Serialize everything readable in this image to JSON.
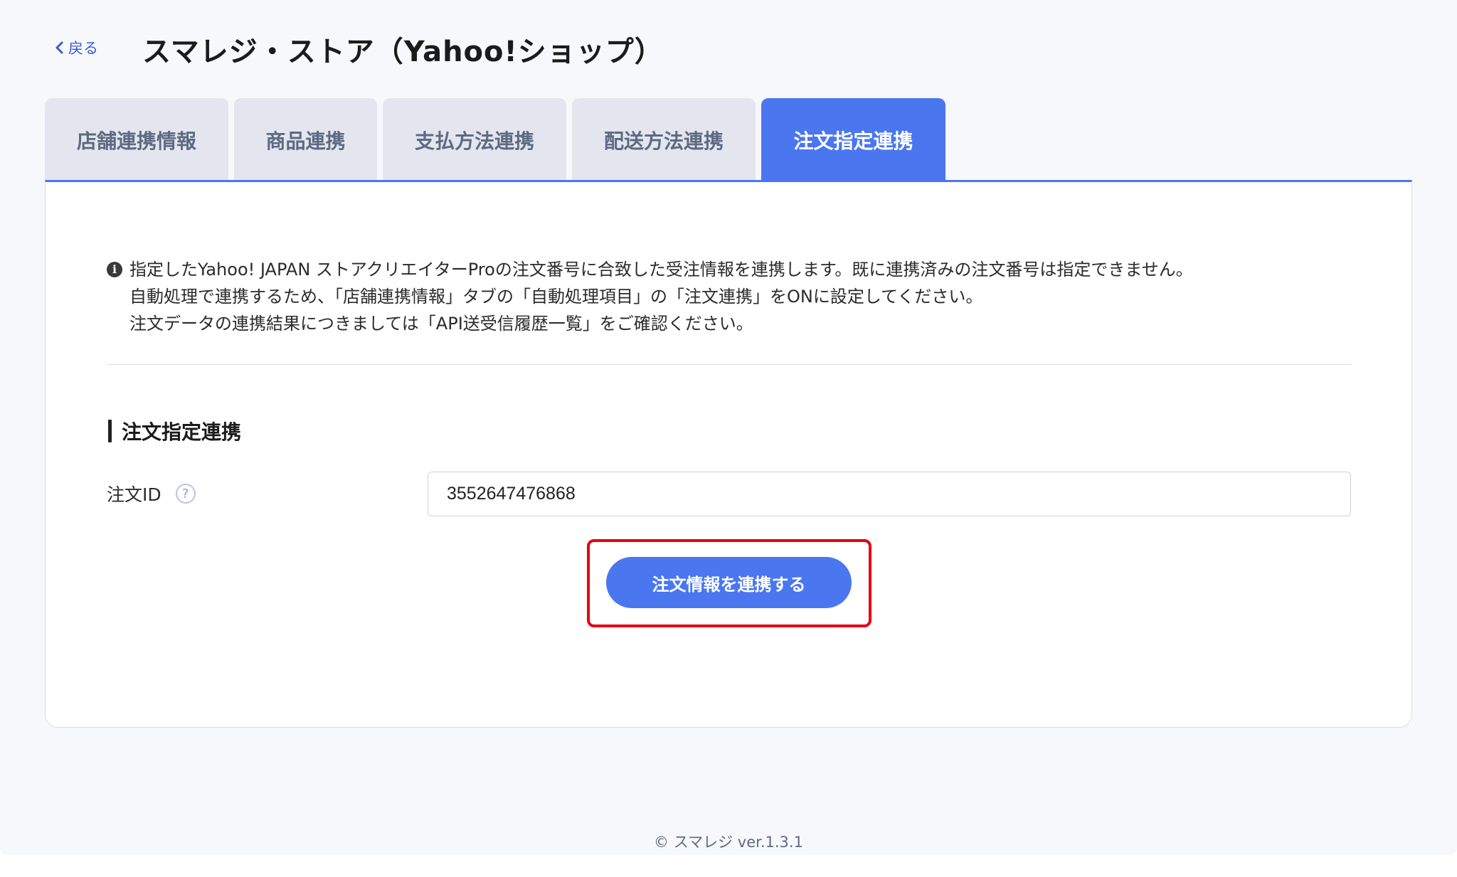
{
  "header": {
    "back_label": "戻る",
    "title": "スマレジ・ストア（Yahoo!ショップ）"
  },
  "tabs": [
    {
      "label": "店舗連携情報",
      "active": false
    },
    {
      "label": "商品連携",
      "active": false
    },
    {
      "label": "支払方法連携",
      "active": false
    },
    {
      "label": "配送方法連携",
      "active": false
    },
    {
      "label": "注文指定連携",
      "active": true
    }
  ],
  "info": {
    "icon": "info-icon",
    "lines": [
      "指定したYahoo! JAPAN ストアクリエイターProの注文番号に合致した受注情報を連携します。既に連携済みの注文番号は指定できません。",
      "自動処理で連携するため、「店舗連携情報」タブの「自動処理項目」の「注文連携」をONに設定してください。",
      "注文データの連携結果につきましては「API送受信履歴一覧」をご確認ください。"
    ]
  },
  "section": {
    "heading": "注文指定連携",
    "field_label": "注文ID",
    "help_icon": "?",
    "order_id_value": "3552647476868",
    "submit_label": "注文情報を連携する"
  },
  "footer": {
    "text": "© スマレジ  ver.1.3.1"
  },
  "colors": {
    "accent": "#4a76f0",
    "highlight": "#e60012",
    "background": "#f7f8fc"
  }
}
